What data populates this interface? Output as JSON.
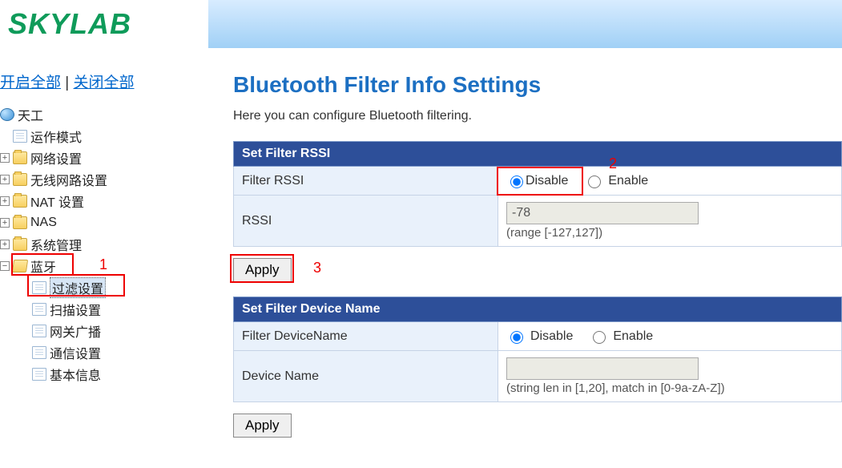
{
  "brand": "SKYLAB",
  "expand_all": "开启全部",
  "collapse_all": "关闭全部",
  "tree": {
    "root": "天工",
    "items": [
      "运作模式",
      "网络设置",
      "无线网路设置",
      "NAT 设置",
      "NAS",
      "系统管理",
      "蓝牙"
    ],
    "bluetooth_children": [
      "过滤设置",
      "扫描设置",
      "网关广播",
      "通信设置",
      "基本信息"
    ]
  },
  "annotations": {
    "one": "1",
    "two": "2",
    "three": "3"
  },
  "page": {
    "title": "Bluetooth Filter Info Settings",
    "desc": "Here you can configure Bluetooth filtering."
  },
  "rssi": {
    "section": "Set Filter RSSI",
    "row1_label": "Filter RSSI",
    "disable": "Disable",
    "enable": "Enable",
    "row2_label": "RSSI",
    "value": "-78",
    "hint": "(range [-127,127])",
    "apply": "Apply"
  },
  "devname": {
    "section": "Set Filter Device Name",
    "row1_label": "Filter DeviceName",
    "disable": "Disable",
    "enable": "Enable",
    "row2_label": "Device Name",
    "value": "",
    "hint": "(string len in [1,20], match in [0-9a-zA-Z])",
    "apply": "Apply"
  }
}
